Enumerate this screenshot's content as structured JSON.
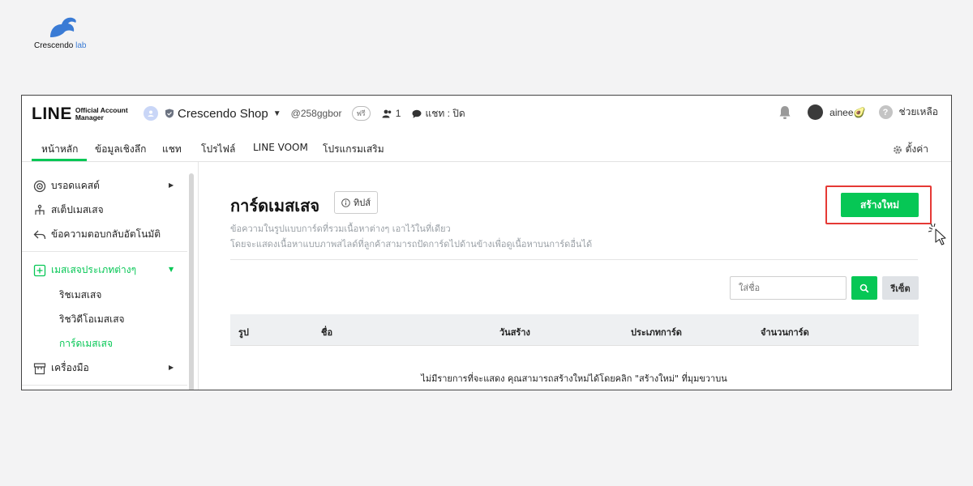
{
  "brand": {
    "name": "Crescendo",
    "name_suffix": "lab",
    "accent": "#3a7bd5"
  },
  "topbar": {
    "logo_big": "LINE",
    "logo_small_1": "Official Account",
    "logo_small_2": "Manager",
    "account_name": "Crescendo Shop",
    "account_id": "@258ggbor",
    "plan_badge": "ฟรี",
    "friends_count": "1",
    "chat_status": "แชท : ปิด",
    "username": "ainee",
    "username_emoji": "🥑",
    "help_label": "ช่วยเหลือ"
  },
  "nav": {
    "items": [
      "หน้าหลัก",
      "ข้อมูลเชิงลึก",
      "แชท",
      "โปรไฟล์",
      "LINE VOOM",
      "โปรแกรมเสริม"
    ],
    "active": "หน้าหลัก",
    "settings_label": "ตั้งค่า",
    "accent": "#06c755"
  },
  "sidebar": {
    "items": [
      {
        "label": "บรอดแคสต์",
        "icon": "broadcast-icon",
        "has_arrow": true
      },
      {
        "label": "สเต็ปเมสเสจ",
        "icon": "step-icon",
        "has_arrow": false
      },
      {
        "label": "ข้อความตอบกลับอัตโนมัติ",
        "icon": "reply-icon",
        "has_arrow": false
      },
      {
        "label": "เมสเสจประเภทต่างๆ",
        "icon": "plus-square-icon",
        "has_arrow": true,
        "active": true
      },
      {
        "label": "เครื่องมือ",
        "icon": "tools-icon",
        "has_arrow": true
      }
    ],
    "sub_items": [
      "ริชเมสเสจ",
      "ริชวิดีโอเมสเสจ",
      "การ์ดเมสเสจ"
    ],
    "active_sub": "การ์ดเมสเสจ"
  },
  "main": {
    "title": "การ์ดเมสเสจ",
    "tips_label": "ทิปส์",
    "desc_line1": "ข้อความในรูปแบบการ์ดที่รวมเนื้อหาต่างๆ เอาไว้ในที่เดียว",
    "desc_line2": "โดยจะแสดงเนื้อหาแบบภาพสไลด์ที่ลูกค้าสามารถปัดการ์ดไปด้านข้างเพื่อดูเนื้อหาบนการ์ดอื่นได้",
    "create_label": "สร้างใหม่",
    "search_placeholder": "ใส่ชื่อ",
    "reset_label": "รีเซ็ต",
    "columns": [
      "รูป",
      "ชื่อ",
      "วันสร้าง",
      "ประเภทการ์ด",
      "จำนวนการ์ด"
    ],
    "empty_message": "ไม่มีรายการที่จะแสดง คุณสามารถสร้างใหม่ได้โดยคลิก \"สร้างใหม่\" ที่มุมขวาบน",
    "highlight_color": "#e53935"
  }
}
